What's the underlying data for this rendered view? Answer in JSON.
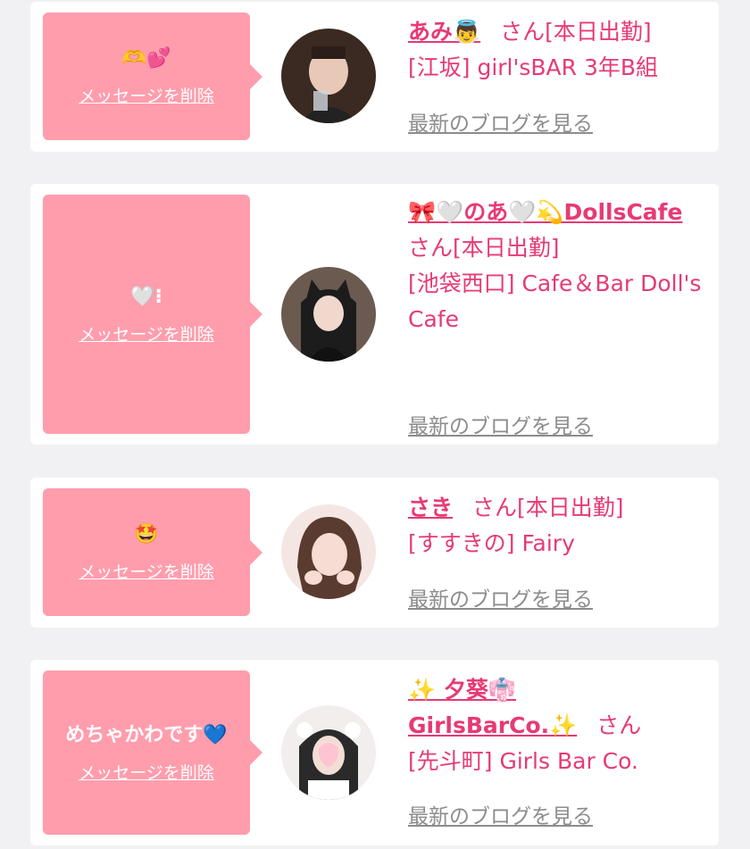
{
  "cards": [
    {
      "message": "🫶💕",
      "delete_label": "メッセージを削除",
      "name": "あみ👼",
      "honorific": "さん",
      "shift": "[本日出勤]",
      "shop": "[江坂] girl'sBAR 3年B組",
      "blog_label": "最新のブログを見る",
      "avatar_colors": [
        "#3a2a22",
        "#e8c9b8"
      ]
    },
    {
      "message": "🤍⁝",
      "delete_label": "メッセージを削除",
      "name": "🎀🤍のあ🤍💫DollsCafe",
      "honorific": "さん",
      "shift": "[本日出勤]",
      "shop": "[池袋西口] Cafe＆Bar Doll's Cafe",
      "blog_label": "最新のブログを見る",
      "avatar_colors": [
        "#1c1c1c",
        "#6b5a4f"
      ]
    },
    {
      "message": "🤩",
      "delete_label": "メッセージを削除",
      "name": "さき",
      "honorific": "さん",
      "shift": "[本日出勤]",
      "shop": "[すすきの] Fairy",
      "blog_label": "最新のブログを見る",
      "avatar_colors": [
        "#f4e6e2",
        "#5a3b2f"
      ]
    },
    {
      "message": "めちゃかわです💙",
      "delete_label": "メッセージを削除",
      "name": "✨ 夕葵👘GirlsBarCo.✨",
      "honorific": "さん",
      "shift": "",
      "shop": "[先斗町] Girls Bar Co.",
      "blog_label": "最新のブログを見る",
      "avatar_colors": [
        "#f2eeee",
        "#ffc4d2"
      ]
    }
  ]
}
